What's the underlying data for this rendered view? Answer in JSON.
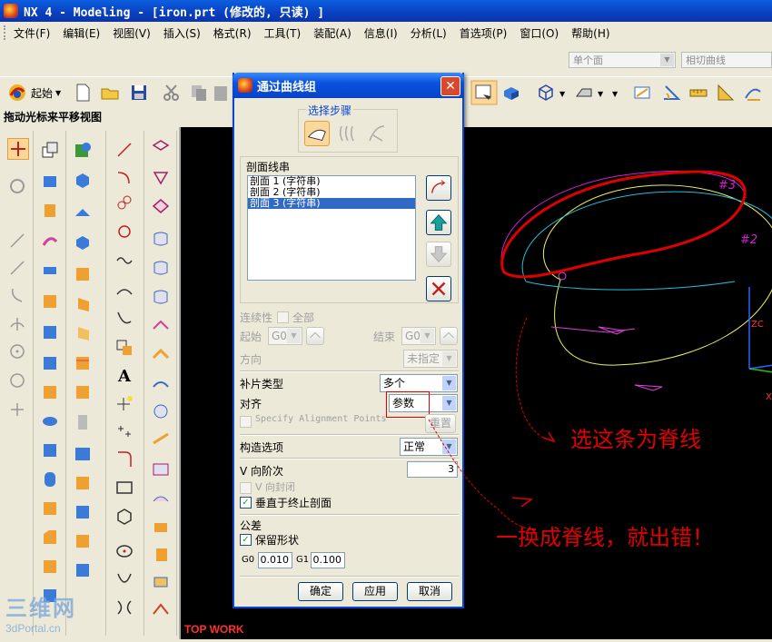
{
  "window": {
    "title": "NX 4 - Modeling - [iron.prt (修改的, 只读) ]"
  },
  "menu": [
    "文件(F)",
    "编辑(E)",
    "视图(V)",
    "插入(S)",
    "格式(R)",
    "工具(T)",
    "装配(A)",
    "信息(I)",
    "分析(L)",
    "首选项(P)",
    "窗口(O)",
    "帮助(H)"
  ],
  "toolbar": {
    "start_label": "起始",
    "filter_combo": "单个面",
    "curve_rule_combo": "相切曲线"
  },
  "hint_line": "拖动光标来平移视图",
  "viewport": {
    "view_name": "TOP WORK",
    "curve_labels": [
      "#3",
      "#2"
    ],
    "axis_labels": [
      "ZC",
      "X"
    ]
  },
  "dialog": {
    "title": "通过曲线组",
    "steps_label": "选择步骤",
    "section_group_label": "剖面线串",
    "sections": [
      "剖面 1 (字符串)",
      "剖面 2 (字符串)",
      "剖面 3 (字符串)"
    ],
    "selected_section_index": 2,
    "continuity_label": "连续性",
    "all_label": "全部",
    "start_label": "起始",
    "start_value": "G0",
    "end_label": "结束",
    "end_value": "G0",
    "direction_label": "方向",
    "direction_value": "未指定",
    "patch_type_label": "补片类型",
    "patch_type_value": "多个",
    "alignment_label": "对齐",
    "alignment_value": "参数",
    "specify_alignment_points_label": "Specify Alignment Points",
    "reset_label": "重置",
    "construction_label": "构造选项",
    "construction_value": "正常",
    "v_degree_label": "V 向阶次",
    "v_degree_value": "3",
    "v_closed_label": "V 向封闭",
    "normal_to_end_label": "垂直于终止剖面",
    "normal_to_end_checked": true,
    "tolerance_label": "公差",
    "keep_shape_label": "保留形状",
    "keep_shape_checked": true,
    "g0_label": "G0",
    "g0_value": "0.010",
    "g1_label": "G1",
    "g1_value": "0.100",
    "ok_label": "确定",
    "apply_label": "应用",
    "cancel_label": "取消"
  },
  "annotations": {
    "select_spine_text": "选这条为脊线",
    "error_text": "一换成脊线，就出错！",
    "color": "#e00000"
  },
  "watermark": {
    "line1": "三维网",
    "line2": "3dPortal.cn"
  }
}
